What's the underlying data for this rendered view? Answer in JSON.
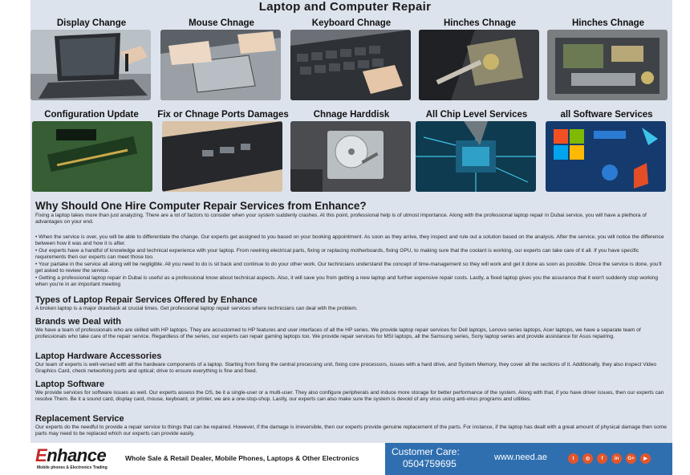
{
  "title": "Laptop and Computer Repair",
  "services_row1": [
    {
      "label": "Display Change",
      "icon": "laptop-display-photo"
    },
    {
      "label": "Mouse Chnage",
      "icon": "touchpad-photo"
    },
    {
      "label": "Keyboard Chnage",
      "icon": "keyboard-photo"
    },
    {
      "label": "Hinches Chnage",
      "icon": "hinge-photo"
    },
    {
      "label": "Hinches Chnage",
      "icon": "motherboard-photo"
    }
  ],
  "services_row2": [
    {
      "label": "Configuration Update",
      "icon": "ram-photo"
    },
    {
      "label": "Fix or Chnage Ports Damages",
      "icon": "ports-photo"
    },
    {
      "label": "Chnage Harddisk",
      "icon": "harddisk-photo"
    },
    {
      "label": "All Chip Level Services",
      "icon": "chip-photo"
    },
    {
      "label": "all Software Services",
      "icon": "software-photo"
    }
  ],
  "why": {
    "heading": "Why Should One Hire Computer Repair Services from Enhance?",
    "intro": "Fixing a laptop takes more than just analyzing. There are a lot of factors to consider when your system suddenly crashes. At this point, professional help is of utmost importance. Along with the professional laptop repair in Dubai service, you will have a plethora of advantages on your end.",
    "bullets": [
      "•  When the service is over, you will be able to differentiate the change. Our experts get assigned to you based on your booking appointment. As soon as they arrive, they inspect and rule out a solution based on the analysis. After the service, you will notice the difference between how it was and how it is after.",
      "• Our experts have a handful of knowledge and technical experience with your laptop. From rewiring electrical parts, fixing or replacing motherboards, fixing GPU, to making sure that the coolant is working, our experts can take care of it all. If you have specific requirements then our experts can meet those too.",
      "• Your partake in the service all along will be negligible. All you need to do is sit back and continue to do your other work. Our technicians understand the concept of time-management so they will work and get it done as soon as possible. Once the service is done, you'll get asked to review the service.",
      "• Getting a professional laptop repair in Dubai is useful as a professional know about technical aspects. Also, it will save you from getting a new laptop and further expensive repair costs. Lastly, a fixed laptop gives you the assurance that it won't suddenly stop working when you're in an important meeting"
    ]
  },
  "types": {
    "heading": "Types of Laptop Repair Services Offered by Enhance",
    "body": "A broken laptop is a major drawback at crucial times. Get professional laptop repair services where technicians can deal with the problem."
  },
  "brands": {
    "heading": "Brands we Deal with",
    "body": "We have a team of professionals who are skilled with HP laptops. They are accustomed to HP features and user interfaces of all the HP series. We provide laptop repair services for Dell laptops, Lenovo series laptops, Acer laptops, we have a separate team of professionals who take care of the repair service. Regardless of the series, our experts can repair gaming laptops too. We provide repair services for MSI laptops, all the Samsung series, Sony laptop series and provide assistance for Asus repairing."
  },
  "hardware": {
    "heading": "Laptop Hardware Accessories",
    "body": "Our team of experts is well-versed with all the hardware components of a laptop. Starting from fixing the central processing unit, fixing core processors, issues with a hard drive, and System Memory, they cover all the sections of it. Additionally, they also inspect Video Graphics Card, check networking ports and optical; drive to ensure everything is fine and fixed."
  },
  "software": {
    "heading": "Laptop Software",
    "body": "We provide services for software issues as well. Our experts assess the OS, be it a single-user or a multi-user. They also configure peripherals and induce more storage for better performance of the system. Along with that, if you have driver issues, then our experts can resolve Them. Be it a sound card, display card, mouse, keyboard, or printer, we are a one-stop-shop. Lastly, our experts can also make sure the system is devoid of any virus using anti-virus programs and utilities."
  },
  "replacement": {
    "heading": "Replacement Service",
    "body": "Our experts do the needful to provide a repair service to things that can be repaired. However, if the damage is irreversible, then our experts provide genuine replacement of the parts. For instance, if the laptop has dealt with a great amount of physical damage then some parts may need to be replaced which our experts can provide easily."
  },
  "footer": {
    "logo_text": "Enhance",
    "logo_sub": "Mobile phones & Electronics Trading",
    "tagline": "Whole Sale & Retail Dealer, Mobile Phones, Laptops & Other Electronics",
    "care_label": "Customer Care:",
    "care_number": "0504759695",
    "website": "www.need.ae",
    "social_color": "#e2562b",
    "band_color": "#2f6fb0",
    "socials": [
      {
        "icon": "twitter-icon",
        "glyph": "t"
      },
      {
        "icon": "instagram-icon",
        "glyph": "◎"
      },
      {
        "icon": "facebook-icon",
        "glyph": "f"
      },
      {
        "icon": "linkedin-icon",
        "glyph": "in"
      },
      {
        "icon": "google-plus-icon",
        "glyph": "G+"
      },
      {
        "icon": "youtube-icon",
        "glyph": "▶"
      }
    ]
  }
}
